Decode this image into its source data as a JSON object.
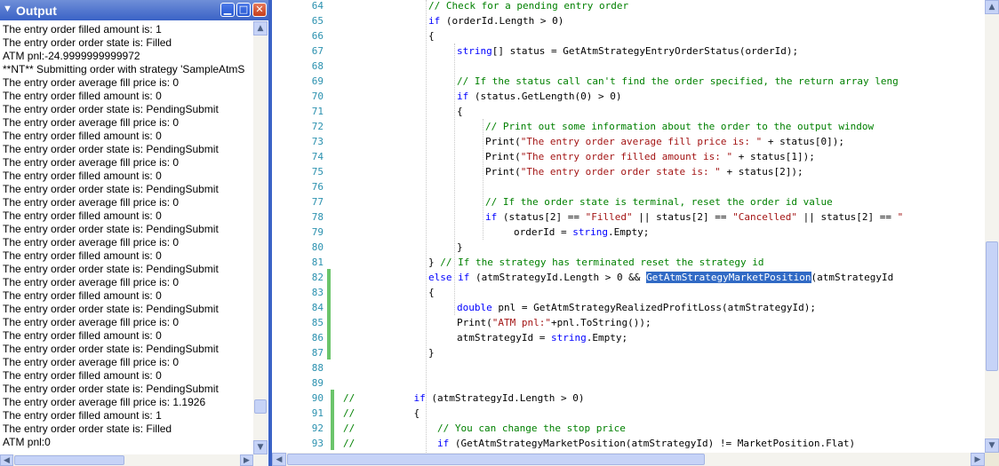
{
  "output_window": {
    "title": "Output",
    "lines": [
      "The entry order filled amount is: 1",
      "The entry order order state is: Filled",
      "ATM pnl:-24.9999999999972",
      "**NT** Submitting order with strategy 'SampleAtmS",
      "The entry order average fill price is: 0",
      "The entry order filled amount is: 0",
      "The entry order order state is: PendingSubmit",
      "The entry order average fill price is: 0",
      "The entry order filled amount is: 0",
      "The entry order order state is: PendingSubmit",
      "The entry order average fill price is: 0",
      "The entry order filled amount is: 0",
      "The entry order order state is: PendingSubmit",
      "The entry order average fill price is: 0",
      "The entry order filled amount is: 0",
      "The entry order order state is: PendingSubmit",
      "The entry order average fill price is: 0",
      "The entry order filled amount is: 0",
      "The entry order order state is: PendingSubmit",
      "The entry order average fill price is: 0",
      "The entry order filled amount is: 0",
      "The entry order order state is: PendingSubmit",
      "The entry order average fill price is: 0",
      "The entry order filled amount is: 0",
      "The entry order order state is: PendingSubmit",
      "The entry order average fill price is: 0",
      "The entry order filled amount is: 0",
      "The entry order order state is: PendingSubmit",
      "The entry order average fill price is: 1.1926",
      "The entry order filled amount is: 1",
      "The entry order order state is: Filled",
      "ATM pnl:0"
    ]
  },
  "editor": {
    "selected_text": "GetAtmStrategyMarketPosition",
    "lines": [
      {
        "no": "64",
        "indent": 3,
        "tokens": [
          {
            "t": "// Check for a pending entry order",
            "c": "cm"
          }
        ]
      },
      {
        "no": "65",
        "indent": 3,
        "tokens": [
          {
            "t": "if",
            "c": "kw"
          },
          {
            "t": " (orderId.Length > 0)",
            "c": ""
          }
        ]
      },
      {
        "no": "66",
        "indent": 3,
        "tokens": [
          {
            "t": "{",
            "c": ""
          }
        ]
      },
      {
        "no": "67",
        "indent": 4,
        "tokens": [
          {
            "t": "string",
            "c": "kw"
          },
          {
            "t": "[] status = GetAtmStrategyEntryOrderStatus(orderId);",
            "c": ""
          }
        ]
      },
      {
        "no": "68",
        "indent": 0,
        "tokens": []
      },
      {
        "no": "69",
        "indent": 4,
        "tokens": [
          {
            "t": "// If the status call can't find the order specified, the return array leng",
            "c": "cm"
          }
        ]
      },
      {
        "no": "70",
        "indent": 4,
        "tokens": [
          {
            "t": "if",
            "c": "kw"
          },
          {
            "t": " (status.GetLength(0) > 0)",
            "c": ""
          }
        ]
      },
      {
        "no": "71",
        "indent": 4,
        "tokens": [
          {
            "t": "{",
            "c": ""
          }
        ]
      },
      {
        "no": "72",
        "indent": 5,
        "tokens": [
          {
            "t": "// Print out some information about the order to the output window",
            "c": "cm"
          }
        ]
      },
      {
        "no": "73",
        "indent": 5,
        "tokens": [
          {
            "t": "Print(",
            "c": ""
          },
          {
            "t": "\"The entry order average fill price is: \"",
            "c": "st"
          },
          {
            "t": " + status[0]);",
            "c": ""
          }
        ]
      },
      {
        "no": "74",
        "indent": 5,
        "tokens": [
          {
            "t": "Print(",
            "c": ""
          },
          {
            "t": "\"The entry order filled amount is: \"",
            "c": "st"
          },
          {
            "t": " + status[1]);",
            "c": ""
          }
        ]
      },
      {
        "no": "75",
        "indent": 5,
        "tokens": [
          {
            "t": "Print(",
            "c": ""
          },
          {
            "t": "\"The entry order order state is: \"",
            "c": "st"
          },
          {
            "t": " + status[2]);",
            "c": ""
          }
        ]
      },
      {
        "no": "76",
        "indent": 0,
        "tokens": []
      },
      {
        "no": "77",
        "indent": 5,
        "tokens": [
          {
            "t": "// If the order state is terminal, reset the order id value",
            "c": "cm"
          }
        ]
      },
      {
        "no": "78",
        "indent": 5,
        "tokens": [
          {
            "t": "if",
            "c": "kw"
          },
          {
            "t": " (status[2] == ",
            "c": ""
          },
          {
            "t": "\"Filled\"",
            "c": "st"
          },
          {
            "t": " || status[2] == ",
            "c": ""
          },
          {
            "t": "\"Cancelled\"",
            "c": "st"
          },
          {
            "t": " || status[2] == ",
            "c": ""
          },
          {
            "t": "\"",
            "c": "st"
          }
        ]
      },
      {
        "no": "79",
        "indent": 6,
        "tokens": [
          {
            "t": "orderId = ",
            "c": ""
          },
          {
            "t": "string",
            "c": "kw"
          },
          {
            "t": ".Empty;",
            "c": ""
          }
        ]
      },
      {
        "no": "80",
        "indent": 4,
        "tokens": [
          {
            "t": "}",
            "c": ""
          }
        ]
      },
      {
        "no": "81",
        "indent": 3,
        "tokens": [
          {
            "t": "} ",
            "c": ""
          },
          {
            "t": "// If the strategy has terminated reset the strategy id",
            "c": "cm"
          }
        ]
      },
      {
        "no": "82",
        "indent": 3,
        "tokens": [
          {
            "t": "else",
            "c": "kw"
          },
          {
            "t": " ",
            "c": ""
          },
          {
            "t": "if",
            "c": "kw"
          },
          {
            "t": " (atmStrategyId.Length > 0 && ",
            "c": ""
          },
          {
            "t": "GetAtmStrategyMarketPosition",
            "c": "hl"
          },
          {
            "t": "(atmStrategyId",
            "c": ""
          }
        ]
      },
      {
        "no": "83",
        "indent": 3,
        "tokens": [
          {
            "t": "{",
            "c": ""
          }
        ]
      },
      {
        "no": "84",
        "indent": 4,
        "tokens": [
          {
            "t": "double",
            "c": "kw"
          },
          {
            "t": " pnl = GetAtmStrategyRealizedProfitLoss(atmStrategyId);",
            "c": ""
          }
        ]
      },
      {
        "no": "85",
        "indent": 4,
        "tokens": [
          {
            "t": "Print(",
            "c": ""
          },
          {
            "t": "\"ATM pnl:\"",
            "c": "st"
          },
          {
            "t": "+pnl.ToString());",
            "c": ""
          }
        ]
      },
      {
        "no": "86",
        "indent": 4,
        "tokens": [
          {
            "t": "atmStrategyId = ",
            "c": ""
          },
          {
            "t": "string",
            "c": "kw"
          },
          {
            "t": ".Empty;",
            "c": ""
          }
        ]
      },
      {
        "no": "87",
        "indent": 3,
        "tokens": [
          {
            "t": "}",
            "c": ""
          }
        ]
      },
      {
        "no": "88",
        "indent": 0,
        "tokens": []
      },
      {
        "no": "89",
        "indent": 0,
        "tokens": []
      },
      {
        "no": "90",
        "indent": 0,
        "tokens": [
          {
            "t": "//          ",
            "c": "cm"
          },
          {
            "t": "if",
            "c": "kw"
          },
          {
            "t": " (atmStrategyId.Length > 0)",
            "c": ""
          }
        ]
      },
      {
        "no": "91",
        "indent": 0,
        "tokens": [
          {
            "t": "//          ",
            "c": "cm"
          },
          {
            "t": "{",
            "c": ""
          }
        ]
      },
      {
        "no": "92",
        "indent": 0,
        "tokens": [
          {
            "t": "//              ",
            "c": "cm"
          },
          {
            "t": "// You can change the stop price",
            "c": "cm"
          }
        ]
      },
      {
        "no": "93",
        "indent": 0,
        "tokens": [
          {
            "t": "//              ",
            "c": "cm"
          },
          {
            "t": "if",
            "c": "kw"
          },
          {
            "t": " (GetAtmStrategyMarketPosition(atmStrategyId) != MarketPosition.Flat)",
            "c": ""
          }
        ]
      }
    ]
  },
  "icons": {
    "window_icon": "output-window-icon",
    "minimize": "minimize-icon",
    "maximize": "maximize-icon",
    "close": "close-icon",
    "scroll_up": "arrow-up-icon",
    "scroll_down": "arrow-down-icon",
    "scroll_left": "arrow-left-icon",
    "scroll_right": "arrow-right-icon"
  },
  "colors": {
    "titlebar": "#3a62c6",
    "keyword": "#0000ff",
    "comment": "#008000",
    "string": "#a31515",
    "line_number": "#2b91af",
    "selection": "#316ac5",
    "change_bar": "#6bc46b"
  }
}
